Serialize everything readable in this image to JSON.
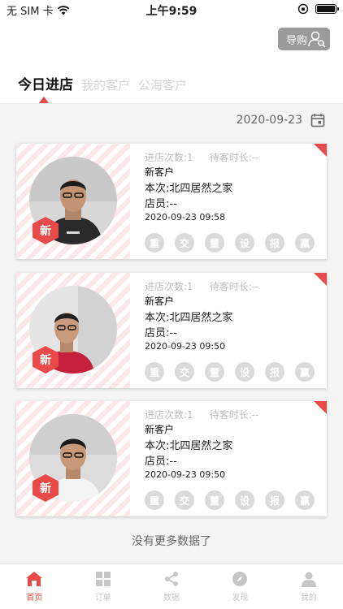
{
  "status_bar": {
    "carrier": "无 SIM 卡",
    "time": "上午9:59"
  },
  "header": {
    "guide_label": "导购",
    "tabs": [
      {
        "label": "今日进店",
        "active": true
      },
      {
        "label": "我的客户",
        "active": false
      },
      {
        "label": "公海客户",
        "active": false
      }
    ]
  },
  "date_filter": {
    "value": "2020-09-23"
  },
  "cards": [
    {
      "badge": "新",
      "visits": "进店次数:1",
      "wait": "待客时长:--",
      "type": "新客户",
      "location": "本次:北四居然之家",
      "staff": "店员:--",
      "time": "2020-09-23 09:58"
    },
    {
      "badge": "新",
      "visits": "进店次数:1",
      "wait": "待客时长:--",
      "type": "新客户",
      "location": "本次:北四居然之家",
      "staff": "店员:--",
      "time": "2020-09-23 09:50"
    },
    {
      "badge": "新",
      "visits": "进店次数:1",
      "wait": "待客时长:--",
      "type": "新客户",
      "location": "本次:北四居然之家",
      "staff": "店员:--",
      "time": "2020-09-23 09:50"
    }
  ],
  "card_actions": [
    "重",
    "交",
    "董",
    "设",
    "报",
    "赢"
  ],
  "footer_text": "没有更多数据了",
  "tabbar": [
    {
      "label": "首页",
      "icon": "home-icon",
      "active": true
    },
    {
      "label": "订单",
      "icon": "grid-icon",
      "active": false
    },
    {
      "label": "数据",
      "icon": "share-icon",
      "active": false
    },
    {
      "label": "发现",
      "icon": "compass-icon",
      "active": false
    },
    {
      "label": "我的",
      "icon": "person-icon",
      "active": false
    }
  ],
  "colors": {
    "accent": "#e84a4a",
    "muted": "#c6c6c6",
    "button_gray": "#9a9a9a"
  }
}
